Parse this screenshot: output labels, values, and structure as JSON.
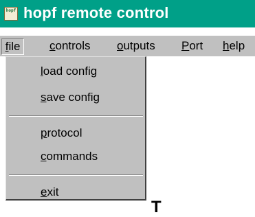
{
  "window": {
    "title": "hopf remote control",
    "icon_text": "hopf"
  },
  "menubar": {
    "items": [
      {
        "label_ul": "f",
        "label_rest": "ile"
      },
      {
        "label_ul": "c",
        "label_rest": "ontrols"
      },
      {
        "label_ul": "o",
        "label_rest": "utputs"
      },
      {
        "label_ul": "P",
        "label_rest": "ort"
      },
      {
        "label_ul": "h",
        "label_rest": "elp"
      }
    ]
  },
  "file_menu": {
    "items": [
      {
        "label_ul": "l",
        "label_rest": "oad config"
      },
      {
        "label_ul": "s",
        "label_rest": "ave config"
      },
      {
        "label_ul": "p",
        "label_rest": "rotocol"
      },
      {
        "label_ul": "c",
        "label_rest": "ommands"
      },
      {
        "label_ul": "e",
        "label_rest": "xit"
      }
    ]
  },
  "background": {
    "partial_text": "T"
  }
}
